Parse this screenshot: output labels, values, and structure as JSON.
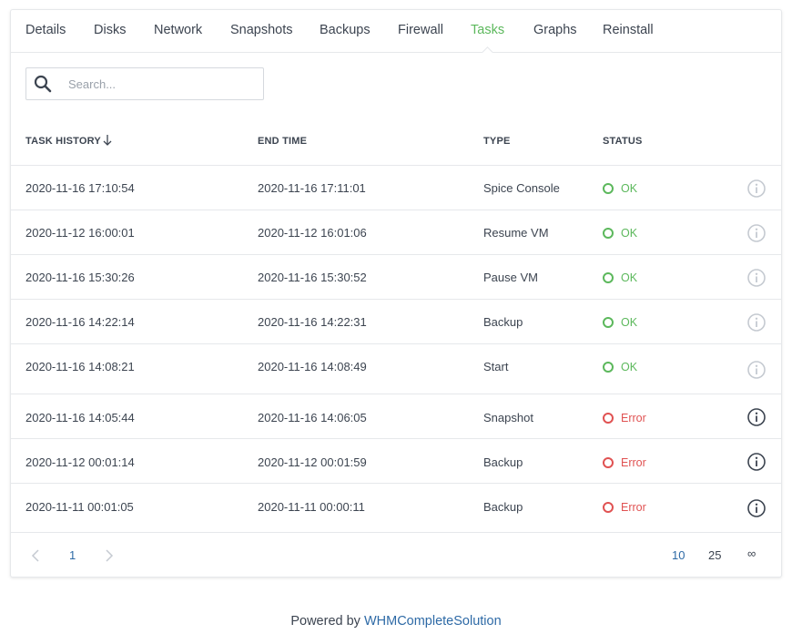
{
  "tabs": [
    {
      "label": "Details"
    },
    {
      "label": "Disks"
    },
    {
      "label": "Network"
    },
    {
      "label": "Snapshots"
    },
    {
      "label": "Backups"
    },
    {
      "label": "Firewall"
    },
    {
      "label": "Tasks"
    },
    {
      "label": "Graphs"
    },
    {
      "label": "Reinstall"
    }
  ],
  "active_tab": "Tasks",
  "search": {
    "placeholder": "Search...",
    "value": ""
  },
  "table": {
    "columns": {
      "task_history": "TASK HISTORY",
      "end_time": "END TIME",
      "type": "TYPE",
      "status": "STATUS"
    },
    "rows": [
      {
        "start": "2020-11-16 17:10:54",
        "end": "2020-11-16 17:11:01",
        "type": "Spice Console",
        "status": "OK"
      },
      {
        "start": "2020-11-12 16:00:01",
        "end": "2020-11-12 16:01:06",
        "type": "Resume VM",
        "status": "OK"
      },
      {
        "start": "2020-11-16 15:30:26",
        "end": "2020-11-16 15:30:52",
        "type": "Pause VM",
        "status": "OK"
      },
      {
        "start": "2020-11-16 14:22:14",
        "end": "2020-11-16 14:22:31",
        "type": "Backup",
        "status": "OK"
      },
      {
        "start": "2020-11-16 14:08:21",
        "end": "2020-11-16 14:08:49",
        "type": "Start",
        "status": "OK"
      },
      {
        "start": "2020-11-16 14:05:44",
        "end": "2020-11-16 14:06:05",
        "type": "Snapshot",
        "status": "Error"
      },
      {
        "start": "2020-11-12 00:01:14",
        "end": "2020-11-12 00:01:59",
        "type": "Backup",
        "status": "Error"
      },
      {
        "start": "2020-11-11 00:01:05",
        "end": "2020-11-11 00:00:11",
        "type": "Backup",
        "status": "Error"
      }
    ]
  },
  "pagination": {
    "current_page": "1",
    "page_sizes": [
      "10",
      "25",
      "∞"
    ],
    "selected_page_size": "10"
  },
  "footer": {
    "powered_by": "Powered by",
    "brand": "WHMCompleteSolution"
  },
  "colors": {
    "accent_active_tab": "#5cb85c",
    "status_ok": "#5cb85c",
    "status_error": "#e05252",
    "link": "#2e6aa6",
    "border": "#e6e8eb"
  },
  "icons": {
    "search": "search-icon",
    "sort": "arrow-down-icon",
    "info": "info-circle-icon",
    "prev": "chevron-left-icon",
    "next": "chevron-right-icon"
  }
}
